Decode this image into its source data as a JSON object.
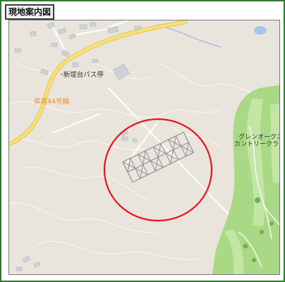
{
  "header": {
    "title": "現地案内図"
  },
  "map": {
    "labels": {
      "bus_stop": "･新堤台バス停",
      "prefectural_road": "県道44号線",
      "golf_course_line1": "グレンオークス",
      "golf_course_line2": "カントリークラブ"
    },
    "marker_color": "#e8141b",
    "road_color": "#f2d95c",
    "golf_course_color": "#a9d984",
    "land_color": "#e9e4dc",
    "road_label_color": "#f08c2a"
  }
}
